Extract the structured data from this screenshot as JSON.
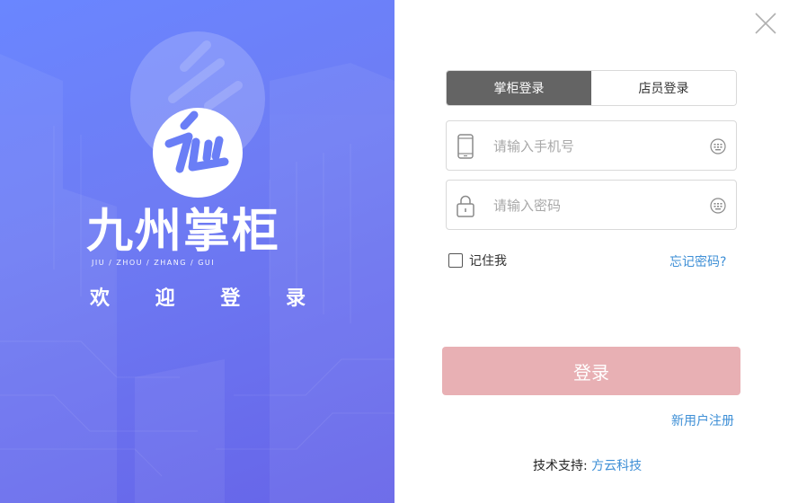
{
  "brand": {
    "name": "九州掌柜",
    "pinyin": "JIU / ZHOU / ZHANG / GUI",
    "welcome": [
      "欢",
      "迎",
      "登",
      "录"
    ],
    "logo_icon": "jz-logo-icon"
  },
  "tabs": [
    {
      "label": "掌柜登录",
      "active": true
    },
    {
      "label": "店员登录",
      "active": false
    }
  ],
  "phone_field": {
    "placeholder": "请输入手机号",
    "value": "",
    "icon": "phone-icon",
    "keyboard_icon": "keyboard-icon"
  },
  "password_field": {
    "placeholder": "请输入密码",
    "value": "",
    "icon": "lock-icon",
    "keyboard_icon": "keyboard-icon"
  },
  "remember": {
    "label": "记住我",
    "checked": false
  },
  "forgot_label": "忘记密码?",
  "login_label": "登录",
  "register_label": "新用户注册",
  "support": {
    "label": "技术支持:",
    "vendor": "方云科技"
  },
  "colors": {
    "left_gradient_start": "#6a86ff",
    "left_gradient_end": "#6664e8",
    "tab_active": "#646464",
    "login_button": "#e8b0b4",
    "link": "#3e8fd6"
  }
}
